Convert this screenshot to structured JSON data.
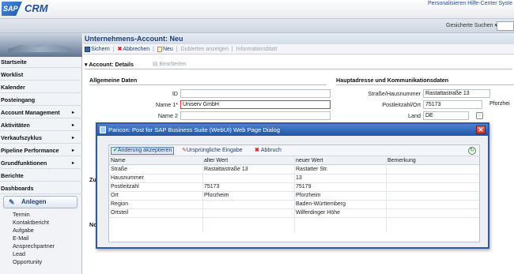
{
  "app": {
    "logo_sap": "SAP",
    "logo_crm": "CRM",
    "top_link": "Personalisieren  Hilfe-Center  Syste",
    "saved_searches": "Gesicherte Suchen ▾"
  },
  "nav": {
    "items": [
      {
        "label": "Startseite",
        "arrow": ""
      },
      {
        "label": "Worklist",
        "arrow": ""
      },
      {
        "label": "Kalender",
        "arrow": ""
      },
      {
        "label": "Posteingang",
        "arrow": ""
      },
      {
        "label": "Account Management",
        "arrow": "▸"
      },
      {
        "label": "Aktivitäten",
        "arrow": "▸"
      },
      {
        "label": "Verkaufszyklus",
        "arrow": "▸"
      },
      {
        "label": "Pipeline Performance",
        "arrow": "▸"
      },
      {
        "label": "Grundfunktionen",
        "arrow": "▸"
      },
      {
        "label": "Berichte",
        "arrow": ""
      },
      {
        "label": "Dashboards",
        "arrow": ""
      }
    ],
    "create_label": "Anlegen",
    "create_items": [
      "Termin",
      "Kontaktbericht",
      "Aufgabe",
      "E-Mail",
      "Ansprechpartner",
      "Lead",
      "Opportunity"
    ]
  },
  "page": {
    "title": "Unternehmens-Account: Neu",
    "actions": {
      "save": "Sichern",
      "cancel": "Abbrechen",
      "new": "Neu",
      "duplicates": "Dubletten anzeigen",
      "info": "Informationsblatt",
      "separator": "|"
    },
    "section": "▾ Account: Details",
    "edit": "Bearbeiten",
    "general_header": "Allgemeine Daten",
    "address_header": "Hauptadresse und Kommunikationsdaten",
    "fields": {
      "id_label": "ID",
      "id_value": "",
      "name1_label": "Name 1*",
      "name1_value": "Uniserv GmbH",
      "name2_label": "Name 2",
      "name2_value": "",
      "street_label": "Straße/Hausnummer",
      "street_value": "Rastattastraße 13",
      "postal_label": "Postleitzahl/Ort",
      "postal_value": "75173",
      "city_value": "Pforzhei",
      "country_label": "Land",
      "country_value": "DE"
    },
    "partial_labels": [
      "Zu",
      "No"
    ]
  },
  "dialog": {
    "title": "Paricon: Post for SAP Business Suite (WebUI)    Web Page Dialog",
    "close": "✕",
    "accept": "Änderung akzeptieren",
    "original": "Ursprüngliche Eingabe",
    "cancel": "Abbruch",
    "columns": [
      "Name",
      "alter Wert",
      "neuer Wert",
      "Bemerkung"
    ],
    "rows": [
      [
        "Straße",
        "Rastattastraße 13",
        "Rastatter Str.",
        ""
      ],
      [
        "Hausnummer",
        "",
        "13",
        ""
      ],
      [
        "Postleitzahl",
        "75173",
        "75179",
        ""
      ],
      [
        "Ort",
        "Pforzheim",
        "Pforzheim",
        ""
      ],
      [
        "Region",
        "",
        "Baden-Württemberg",
        ""
      ],
      [
        "Ortsteil",
        "",
        "Wilferdinger Höhe",
        ""
      ]
    ]
  },
  "colors": {
    "brand": "#1f4f98",
    "error": "#dd3333",
    "dialog_title": "#2155a6"
  }
}
